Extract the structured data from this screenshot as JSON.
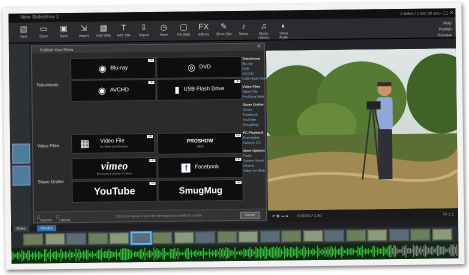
{
  "app": {
    "title": "New Slideshow 2",
    "right_status": "1 slides / 1 min 30 sec"
  },
  "toolbar": {
    "items": [
      {
        "label": "New",
        "icon": "new-icon"
      },
      {
        "label": "Open",
        "icon": "folder-icon"
      },
      {
        "label": "Save",
        "icon": "save-icon"
      },
      {
        "label": "Import",
        "icon": "import-icon"
      },
      {
        "label": "Add Slide",
        "icon": "add-slide-icon"
      },
      {
        "label": "Add Title",
        "icon": "title-icon"
      },
      {
        "label": "Import",
        "icon": "import2-icon"
      },
      {
        "label": "Timer",
        "icon": "timer-icon"
      },
      {
        "label": "Fill Slide",
        "icon": "fill-icon"
      },
      {
        "label": "Effects",
        "icon": "fx-icon"
      },
      {
        "label": "Show Opt",
        "icon": "options-icon"
      },
      {
        "label": "Music",
        "icon": "music-icon"
      },
      {
        "label": "Music Library",
        "icon": "library-icon"
      },
      {
        "label": "Show Audio",
        "icon": "audio-icon"
      }
    ],
    "right_lines": [
      "Help",
      "Publish",
      "Preview"
    ]
  },
  "dialog": {
    "title": "Publish Your Show",
    "categories": [
      "Televisions",
      "Video Files",
      "Share Online"
    ],
    "buttons": {
      "bluray": "Blu-ray",
      "dvd": "DVD",
      "avchd": "AVCHD",
      "usb": "USB Flash Drive",
      "videofile": "Video File",
      "videofile_sub": "for Web and Devices",
      "proshow": "PROSHOW",
      "proshow_sub": "WEB",
      "vimeo": "vimeo",
      "vimeo_sub": "Showcase a Lifetime of Videos",
      "facebook": "Facebook",
      "youtube": "YouTube",
      "smugmug": "SmugMug",
      "hd_badge": "HD"
    },
    "footer": {
      "check1": "Options",
      "check2": "Upload",
      "hint": "Click the name or icon for the output you want to create",
      "cancel": "Cancel"
    },
    "side": {
      "sections": [
        {
          "head": "Televisions",
          "items": [
            "Blu-ray",
            "DVD",
            "AVCHD",
            "USB Flash Drive"
          ]
        },
        {
          "head": "Video Files",
          "items": [
            "Video File",
            "ProShow Web"
          ]
        },
        {
          "head": "Share Online",
          "items": [
            "Vimeo",
            "Facebook",
            "YouTube",
            "SmugMug"
          ]
        },
        {
          "head": "PC Playback",
          "items": [
            "Executable",
            "Autorun CD"
          ]
        },
        {
          "head": "More Options",
          "items": [
            "Flash",
            "Screen Saver",
            "Device",
            "Video for Web"
          ]
        }
      ]
    }
  },
  "player": {
    "timecode": "0:00:00 / 1:30",
    "zoom_label": "Fit 1:1"
  },
  "timeline": {
    "tabs": [
      "Slides",
      "Timeline"
    ],
    "thumb_count": 20
  },
  "colors": {
    "accent": "#3a8fd6",
    "waveform": "#39c23c",
    "youtube_red": "#d32323",
    "facebook_blue": "#3b5998"
  }
}
